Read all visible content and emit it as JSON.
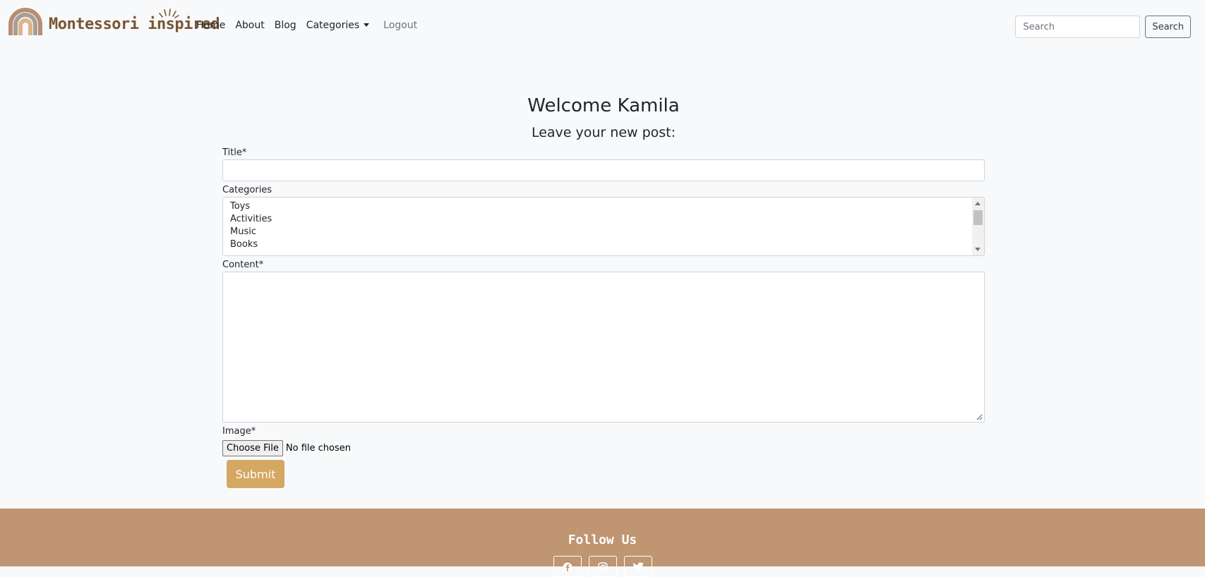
{
  "brand": {
    "name": "Montessori inspired",
    "logo_icon": "rainbow-icon",
    "colors": {
      "outer": "#b78e73",
      "middle": "#a89f94",
      "inner": "#dcb58a",
      "text": "#7a5533"
    }
  },
  "nav": {
    "links": [
      {
        "label": "Home"
      },
      {
        "label": "About"
      },
      {
        "label": "Blog"
      },
      {
        "label": "Categories",
        "dropdown": true
      },
      {
        "label": "Logout"
      }
    ]
  },
  "search": {
    "placeholder": "Search",
    "button_label": "Search"
  },
  "form": {
    "heading": "Welcome Kamila",
    "subheading": "Leave your new post:",
    "title_label": "Title*",
    "title_value": "",
    "categories_label": "Categories",
    "categories_options": [
      "Toys",
      "Activities",
      "Music",
      "Books"
    ],
    "content_label": "Content*",
    "content_value": "",
    "image_label": "Image*",
    "file_button_label": "Choose File",
    "file_status": "No file chosen",
    "submit_label": "Submit"
  },
  "footer": {
    "title": "Follow Us",
    "social": [
      {
        "icon": "facebook-icon"
      },
      {
        "icon": "instagram-icon"
      },
      {
        "icon": "twitter-icon"
      }
    ],
    "background": "#bf9572"
  },
  "colors": {
    "accent": "#d4a862",
    "page_bg": "#f8f9fa"
  }
}
